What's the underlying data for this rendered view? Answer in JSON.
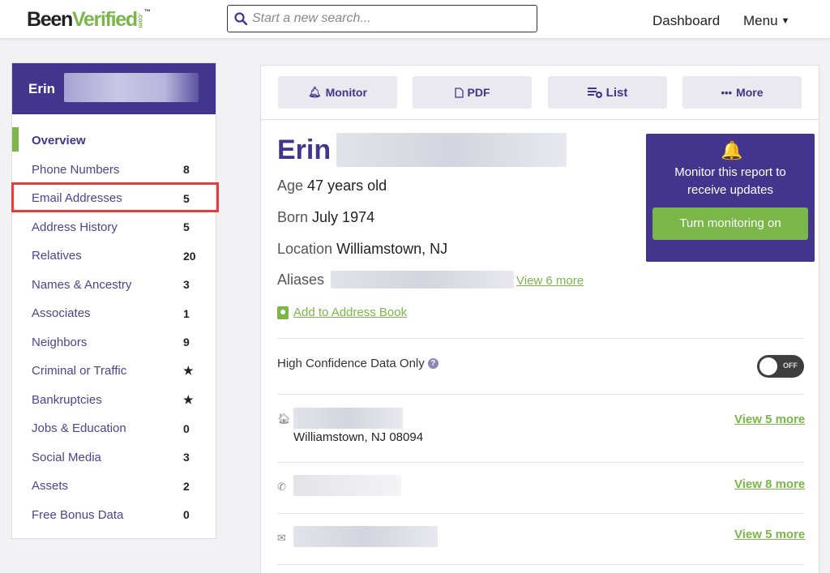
{
  "header": {
    "logo_been": "Been",
    "logo_verified": "Verified",
    "logo_com": ".com",
    "logo_tm": "™",
    "search_placeholder": "Start a new search...",
    "dashboard": "Dashboard",
    "menu": "Menu"
  },
  "sidebar": {
    "name": "Erin",
    "items": [
      {
        "label": "Overview",
        "count": ""
      },
      {
        "label": "Phone Numbers",
        "count": "8"
      },
      {
        "label": "Email Addresses",
        "count": "5"
      },
      {
        "label": "Address History",
        "count": "5"
      },
      {
        "label": "Relatives",
        "count": "20"
      },
      {
        "label": "Names & Ancestry",
        "count": "3"
      },
      {
        "label": "Associates",
        "count": "1"
      },
      {
        "label": "Neighbors",
        "count": "9"
      },
      {
        "label": "Criminal or Traffic",
        "count": "★"
      },
      {
        "label": "Bankruptcies",
        "count": "★"
      },
      {
        "label": "Jobs & Education",
        "count": "0"
      },
      {
        "label": "Social Media",
        "count": "3"
      },
      {
        "label": "Assets",
        "count": "2"
      },
      {
        "label": "Free Bonus Data",
        "count": "0"
      }
    ]
  },
  "toolbar": {
    "monitor": "Monitor",
    "pdf": "PDF",
    "list": "List",
    "more": "More"
  },
  "report": {
    "first_name": "Erin",
    "age_label": "Age",
    "age_value": "47 years old",
    "born_label": "Born",
    "born_value": "July 1974",
    "location_label": "Location",
    "location_value": "Williamstown, NJ",
    "aliases_label": "Aliases",
    "aliases_more": "View 6 more",
    "add_book": "Add to Address Book",
    "high_confidence": "High Confidence Data Only",
    "toggle_state": "OFF"
  },
  "monitor_card": {
    "text": "Monitor this report to receive updates",
    "button": "Turn monitoring on"
  },
  "records": {
    "address_city": "Williamstown, NJ 08094",
    "address_more": "View 5 more",
    "phone_more": "View 8 more",
    "email_more": "View 5 more"
  },
  "colors": {
    "brand_purple": "#43358e",
    "brand_green": "#7ab648",
    "highlight_red": "#e83c3c"
  }
}
